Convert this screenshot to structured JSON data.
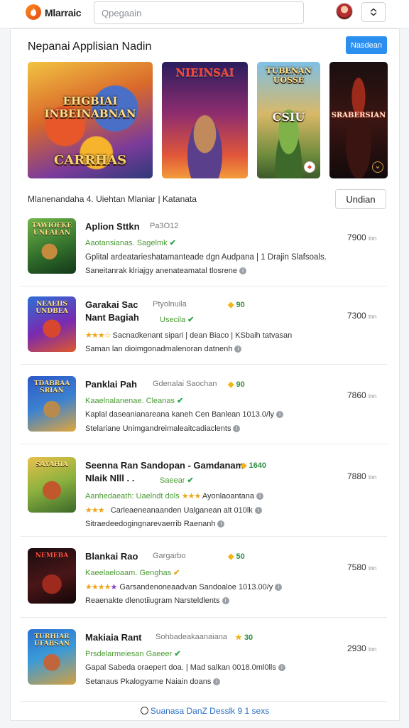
{
  "topbar": {
    "app_title": "Mlarraic",
    "search_placeholder": "Qpegaain",
    "logo_icon": "flame-logo-icon",
    "avatar_icon": "user-avatar",
    "menu_icon": "expand-icon"
  },
  "section": {
    "title": "Nepanai Applisian Nadin",
    "action_label": "Nasdean"
  },
  "banners": [
    {
      "title_top": "EHGBIAI\nINBEINABNAN",
      "title_bottom": "CARRHAS"
    },
    {
      "title_top": "NIEINSAI"
    },
    {
      "title_top": "TUBENAN\nUOSSE",
      "title_bottom": "CSIU"
    },
    {
      "title_top": "SRABERSIAN"
    }
  ],
  "filter": {
    "label": "Mlanenandaha 4. Uiehtan Mlaniar | Katanata",
    "button_label": "Undian"
  },
  "apps": [
    {
      "thumb_label": "TAWIOEKE\nUNEAEAN",
      "name": "Aplion Sttkn",
      "developer": "Pa3O12",
      "meta": "Aaotansianas. Sagelmk",
      "desc1": "Gplital ardeatarieshatamanteade dgn Audpana | 1 Drajin Slafsoals.",
      "desc2": "Saneitanrak klriajgy anenateamatal tlosrene",
      "price": "7900",
      "unit": "tnn"
    },
    {
      "thumb_label": "NEAEIIS\nUNDBEA",
      "name": "Garakai Sac",
      "name2": "Nant Bagiah",
      "developer": "Ptyolnuila",
      "rating": "90",
      "meta": "Usecila",
      "stars": "★★★☆",
      "desc1": "Sacnadkenant sipari | dean  Biaco | KSbaih tatvasan",
      "desc2": "Saman lan dioimgonadmalenoran datnenh",
      "price": "7300",
      "unit": "tnn"
    },
    {
      "thumb_label": "TDABRAA\nSRIAN",
      "name": "Panklai Pah",
      "developer": "Gdenalai Saochan",
      "rating": "90",
      "meta": "Kaaelnalanenae. Cleanas",
      "desc1": "Kaplal daseanianareana kaneh Cen Banlean 1013.0/ly",
      "desc2": "Stelariane Unimgandreimaleaitcadiaclents",
      "price": "7860",
      "unit": "tnn"
    },
    {
      "thumb_label": "SAYAHIA",
      "name": "Seenna Ran Sandopan - Gamdanam",
      "name2": "Nlaik Nlll . .",
      "rating": "1640",
      "meta": "Aanhedaeath: Uaelndt dols",
      "meta_suffix": "Ayonlaoantana",
      "stars": "★★★",
      "desc1": "Carleaeneanaanden Ualganean alt 010lk",
      "desc2": "Sitraedeedogingnarevaerrib Raenanh",
      "price": "7880",
      "unit": "tnn"
    },
    {
      "thumb_label": "NEMEBA",
      "name": "Blankai Rao",
      "developer": "Gargarbo",
      "rating": "50",
      "meta": "Kaeelaeloaam. Genghas",
      "stars": "★★★★",
      "desc1": "Garsandenoneaadvan Sandoaloe 1013.00/y",
      "desc2": "Reaenakte dlenotiiugram Narsteldlents",
      "price": "7580",
      "unit": "tnn"
    },
    {
      "thumb_label": "TURHIAR\nUFABSAN",
      "name": "Makiaia Rant",
      "developer": "Sohbadeakaanaiana",
      "rating": "30",
      "meta": "Prsdelarmeiesan Gaeeer",
      "desc1": "Gapal Sabeda oraepert  doa. | Mad salkan 0018.0ml0lls",
      "desc2": "Setanaus Pkalogyame Naiain doans",
      "price": "2930",
      "unit": "tnn"
    }
  ],
  "footer": {
    "text": "Suanasa DanZ Desslk 9 1 sexs"
  },
  "colors": {
    "accent": "#2b8ff0",
    "green": "#4a9b33",
    "star": "#f1b519"
  }
}
